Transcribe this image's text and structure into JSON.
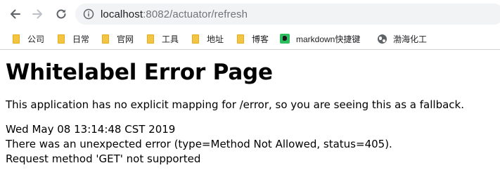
{
  "browser": {
    "url_host": "localhost",
    "url_rest": ":8082/actuator/refresh",
    "icons": {
      "back": "arrow-left-icon",
      "forward": "arrow-right-icon",
      "reload": "reload-icon",
      "site_info": "info-icon"
    }
  },
  "bookmarks": [
    {
      "label": "公司",
      "icon": "folder-icon"
    },
    {
      "label": "日常",
      "icon": "folder-icon"
    },
    {
      "label": "官网",
      "icon": "folder-icon"
    },
    {
      "label": "工具",
      "icon": "folder-icon"
    },
    {
      "label": "地址",
      "icon": "folder-icon"
    },
    {
      "label": "博客",
      "icon": "folder-icon"
    },
    {
      "label": "markdown快捷键",
      "icon": "evernote-icon"
    },
    {
      "label": "渤海化工",
      "icon": "globe-icon"
    }
  ],
  "page": {
    "title": "Whitelabel Error Page",
    "message": "This application has no explicit mapping for /error, so you are seeing this as a fallback.",
    "timestamp": "Wed May 08 13:14:48 CST 2019",
    "error_line": "There was an unexpected error (type=Method Not Allowed, status=405).",
    "detail_line": "Request method 'GET' not supported"
  },
  "colors": {
    "folder": "#f4c542",
    "evernote": "#2dbe60",
    "omnibox_bg": "#f1f3f4",
    "url_rest": "#70757a"
  }
}
